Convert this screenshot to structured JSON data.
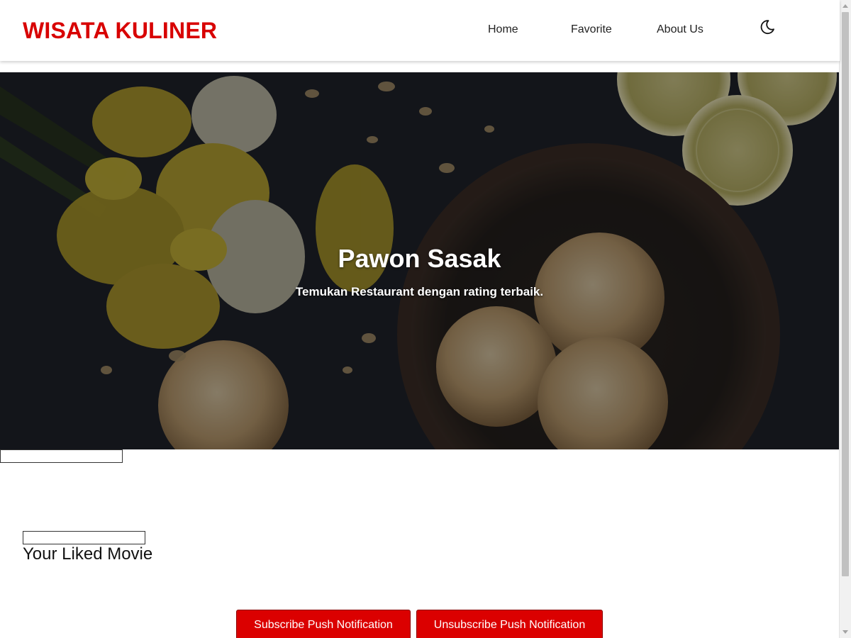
{
  "header": {
    "brand": "WISATA KULINER",
    "nav": [
      {
        "label": "Home"
      },
      {
        "label": "Favorite"
      },
      {
        "label": "About Us"
      }
    ],
    "theme_toggle_icon": "moon-icon"
  },
  "hero": {
    "title": "Pawon Sasak",
    "subtitle": "Temukan Restaurant dengan rating terbaik."
  },
  "main": {
    "section_title": "Your Liked Movie"
  },
  "buttons": {
    "subscribe": "Subscribe Push Notification",
    "unsubscribe": "Unsubscribe Push Notification"
  },
  "colors": {
    "brand": "#d80000",
    "button": "#db0000"
  }
}
